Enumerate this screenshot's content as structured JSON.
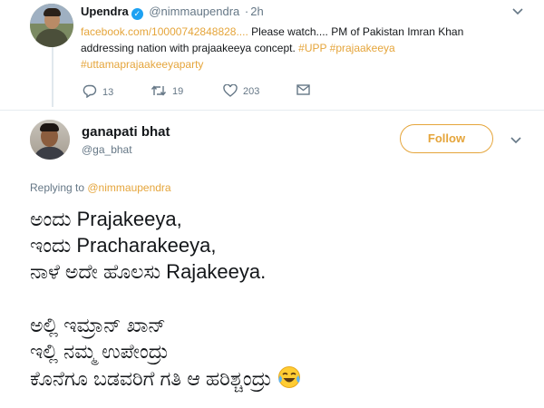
{
  "original_tweet": {
    "author_name": "Upendra",
    "handle": "@nimmaupendra",
    "separator": "·",
    "time": "2h",
    "text_link": "facebook.com/10000742848828....",
    "text_part1": " Please watch.... PM of Pakistan Imran Khan addressing nation with prajaakeeya concept. ",
    "hashtag1": "#UPP",
    "hashtag2": "#prajaakeeya",
    "hashtag3": "#uttamaprajaakeeyaparty",
    "replies": "13",
    "retweets": "19",
    "likes": "203",
    "icons": {
      "reply": "reply-icon",
      "retweet": "retweet-icon",
      "like": "heart-icon",
      "dm": "envelope-icon",
      "more": "chevron-down-icon"
    }
  },
  "reply_tweet": {
    "author_name": "ganapati bhat",
    "handle": "@ga_bhat",
    "follow_label": "Follow",
    "replying_prefix": "Replying to ",
    "replying_to": "@nimmaupendra",
    "lines": [
      "ಅಂದು Prajakeeya,",
      "ಇಂದು Pracharakeeya,",
      "ನಾಳೆ ಅದೇ ಹೊಲಸು Rajakeeya.",
      "ಅಲ್ಲಿ ಇಮ್ರಾನ್ ಖಾನ್",
      "ಇಲ್ಲಿ ನಮ್ಮ ಉಪೇಂದ್ರು",
      "ಕೊನೆಗೂ ಬಡವರಿಗೆ ಗತಿ ಆ ಹರಿಶ್ಚಂದ್ರು"
    ],
    "emoji": "face-with-tears-of-joy-icon"
  },
  "colors": {
    "accent": "#e5a53b",
    "verified": "#1da1f2",
    "muted_text": "#657786"
  }
}
